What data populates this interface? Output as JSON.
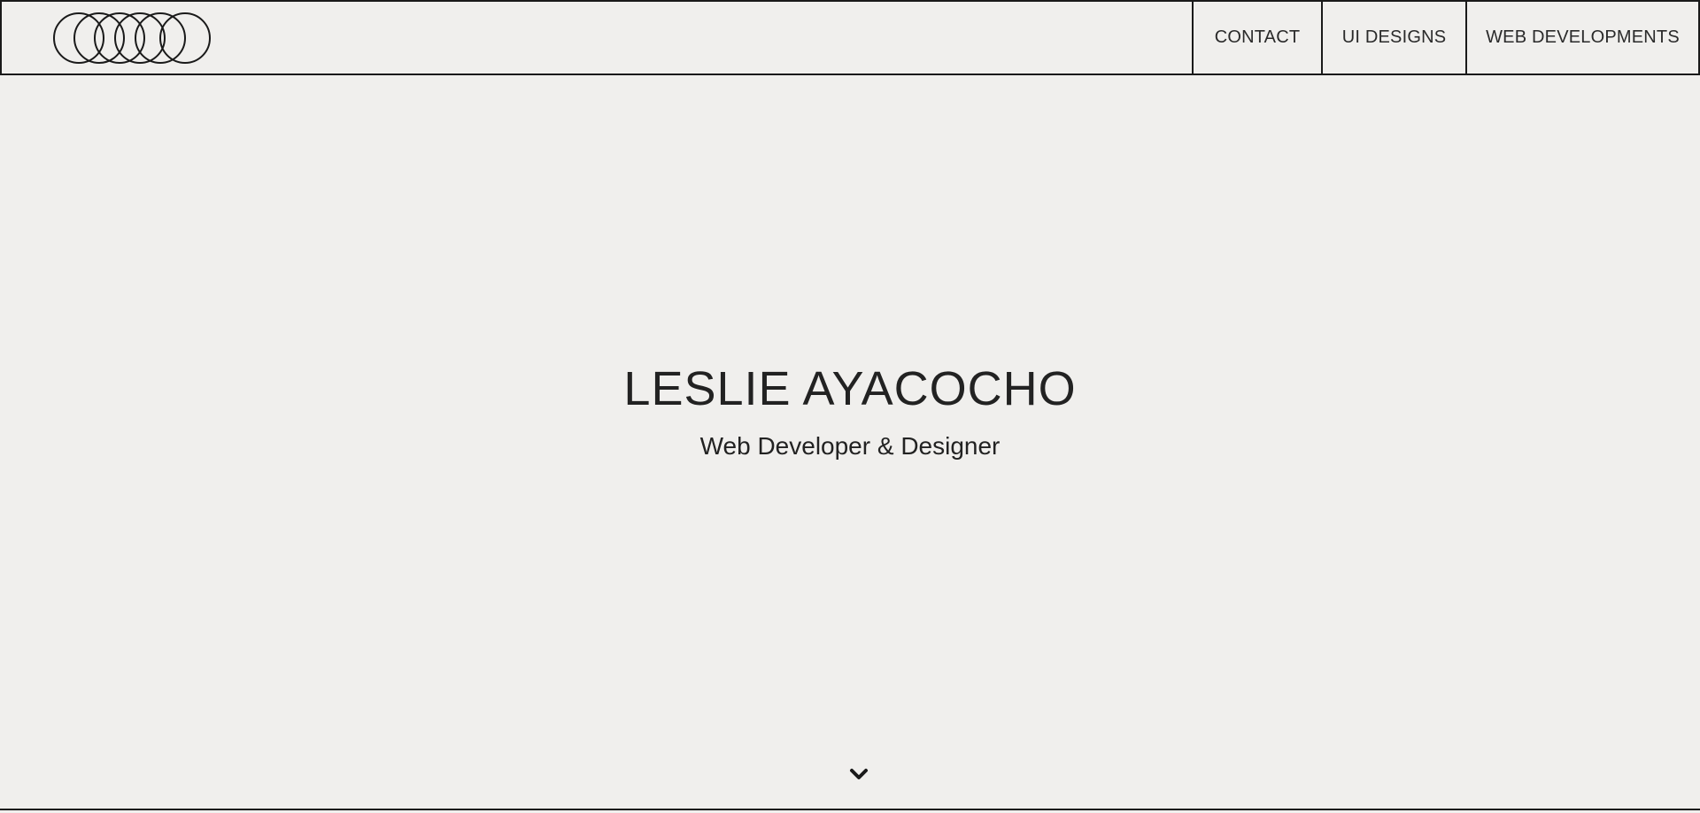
{
  "header": {
    "logo": {
      "icon": "interlocking-circles-logo"
    },
    "nav": [
      {
        "label": "CONTACT"
      },
      {
        "label": "UI DESIGNS"
      },
      {
        "label": "WEB DEVELOPMENTS"
      }
    ]
  },
  "hero": {
    "title": "LESLIE AYACOCHO",
    "subtitle": "Web Developer & Designer",
    "scroll_icon": "chevron-down-icon"
  },
  "colors": {
    "background": "#f0efed",
    "text": "#222222",
    "border": "#1a1a1a"
  }
}
